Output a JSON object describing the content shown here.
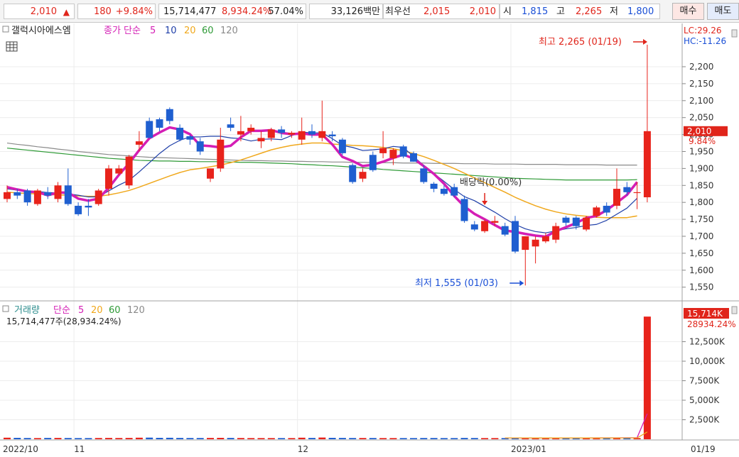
{
  "quote_bar": {
    "price": "2,010",
    "arrow": "▲",
    "change": "180",
    "change_pct": "+9.84%",
    "volume": "15,714,477",
    "volume_ratio": "8,934.24%",
    "turnover": "57.04%",
    "amount": "33,126백만",
    "best_bid_label": "최우선",
    "best_ask": "2,015",
    "best_bid": "2,010",
    "open_label": "시",
    "open": "1,815",
    "high_label": "고",
    "high": "2,265",
    "low_label": "저",
    "low": "1,800",
    "buy_label": "매수",
    "sell_label": "매도"
  },
  "price_legend": {
    "name": "갤럭시아에스엠",
    "ma_label": "종가 단순",
    "ma_periods": [
      "5",
      "10",
      "20",
      "60",
      "120"
    ]
  },
  "volume_legend": {
    "name": "거래량",
    "ma_label": "단순",
    "ma_periods": [
      "5",
      "20",
      "60",
      "120"
    ],
    "current_text": "15,714,477주(28,934.24%)"
  },
  "annotations": {
    "high_text": "최고 2,265 (01/19)",
    "low_text": "최저 1,555 (01/03)",
    "dividend_text": "배당락(0.00%)",
    "lc_text": "LC:29.26",
    "hc_text": "HC:-11.26",
    "last_price_tag": "2,010",
    "last_pct_tag": "9.84%",
    "last_vol_tag": "15,714K",
    "last_vol_pct_tag": "28934.24%"
  },
  "colors": {
    "up": "#e8231b",
    "down": "#1f5fd0",
    "ma5": "#d41eb5",
    "ma10": "#1f3fa8",
    "ma20": "#f0a81c",
    "ma60": "#2e9a36",
    "ma120": "#8a8a8a",
    "volume_ma5": "#d41eb5",
    "volume_ma20": "#f0a81c",
    "volume_ma60": "#2e9a36",
    "volume_ma120": "#8a8a8a"
  },
  "chart_data": {
    "type": "candlestick",
    "price_axis": {
      "range": [
        1520,
        2290
      ],
      "ticks": [
        1550,
        1600,
        1650,
        1700,
        1750,
        1800,
        1850,
        1900,
        1950,
        2000,
        2050,
        2100,
        2150,
        2200
      ],
      "tick_labels": [
        "1,550",
        "1,600",
        "1,650",
        "1,700",
        "1,750",
        "1,800",
        "1,850",
        "1,900",
        "1,950",
        "2,000",
        "2,050",
        "2,100",
        "2,150",
        "2,200"
      ]
    },
    "volume_axis": {
      "range": [
        0,
        16000
      ],
      "ticks": [
        2500,
        5000,
        7500,
        10000,
        12500
      ],
      "tick_labels": [
        "2,500K",
        "5,000K",
        "7,500K",
        "10,000K",
        "12,500K"
      ]
    },
    "x_axis": {
      "labels": [
        {
          "text": "2022/10",
          "index": 0
        },
        {
          "text": "11",
          "index": 7
        },
        {
          "text": "12",
          "index": 29
        },
        {
          "text": "2023/01",
          "index": 50
        },
        {
          "text": "01/19",
          "index": 63
        }
      ]
    },
    "candles": [
      {
        "o": 1810,
        "h": 1850,
        "l": 1800,
        "c": 1830
      },
      {
        "o": 1830,
        "h": 1840,
        "l": 1810,
        "c": 1820
      },
      {
        "o": 1835,
        "h": 1840,
        "l": 1790,
        "c": 1800
      },
      {
        "o": 1795,
        "h": 1840,
        "l": 1790,
        "c": 1835
      },
      {
        "o": 1830,
        "h": 1845,
        "l": 1810,
        "c": 1820
      },
      {
        "o": 1810,
        "h": 1860,
        "l": 1800,
        "c": 1850
      },
      {
        "o": 1850,
        "h": 1900,
        "l": 1790,
        "c": 1795
      },
      {
        "o": 1790,
        "h": 1800,
        "l": 1760,
        "c": 1765
      },
      {
        "o": 1790,
        "h": 1810,
        "l": 1760,
        "c": 1785
      },
      {
        "o": 1795,
        "h": 1840,
        "l": 1790,
        "c": 1835
      },
      {
        "o": 1840,
        "h": 1910,
        "l": 1820,
        "c": 1900
      },
      {
        "o": 1885,
        "h": 1910,
        "l": 1880,
        "c": 1900
      },
      {
        "o": 1850,
        "h": 1940,
        "l": 1840,
        "c": 1935
      },
      {
        "o": 1970,
        "h": 2010,
        "l": 1950,
        "c": 1980
      },
      {
        "o": 2040,
        "h": 2050,
        "l": 1990,
        "c": 1990
      },
      {
        "o": 2045,
        "h": 2050,
        "l": 2010,
        "c": 2020
      },
      {
        "o": 2075,
        "h": 2080,
        "l": 2030,
        "c": 2040
      },
      {
        "o": 2020,
        "h": 2030,
        "l": 1980,
        "c": 1985
      },
      {
        "o": 1995,
        "h": 2000,
        "l": 1970,
        "c": 1985
      },
      {
        "o": 1980,
        "h": 1990,
        "l": 1940,
        "c": 1950
      },
      {
        "o": 1870,
        "h": 1900,
        "l": 1860,
        "c": 1900
      },
      {
        "o": 1900,
        "h": 2020,
        "l": 1890,
        "c": 1985
      },
      {
        "o": 2030,
        "h": 2050,
        "l": 2010,
        "c": 2020
      },
      {
        "o": 2000,
        "h": 2055,
        "l": 1980,
        "c": 2010
      },
      {
        "o": 2010,
        "h": 2030,
        "l": 2000,
        "c": 2020
      },
      {
        "o": 1980,
        "h": 2010,
        "l": 1960,
        "c": 1990
      },
      {
        "o": 1990,
        "h": 2020,
        "l": 1980,
        "c": 2015
      },
      {
        "o": 2015,
        "h": 2025,
        "l": 1990,
        "c": 2005
      },
      {
        "o": 2000,
        "h": 2010,
        "l": 1990,
        "c": 2005
      },
      {
        "o": 1985,
        "h": 2050,
        "l": 1970,
        "c": 2010
      },
      {
        "o": 2010,
        "h": 2030,
        "l": 1990,
        "c": 2000
      },
      {
        "o": 1990,
        "h": 2100,
        "l": 1980,
        "c": 2010
      },
      {
        "o": 2000,
        "h": 2010,
        "l": 1980,
        "c": 1995
      },
      {
        "o": 1985,
        "h": 1990,
        "l": 1940,
        "c": 1945
      },
      {
        "o": 1910,
        "h": 1915,
        "l": 1855,
        "c": 1860
      },
      {
        "o": 1870,
        "h": 1900,
        "l": 1860,
        "c": 1890
      },
      {
        "o": 1940,
        "h": 1950,
        "l": 1890,
        "c": 1895
      },
      {
        "o": 1945,
        "h": 2010,
        "l": 1930,
        "c": 1960
      },
      {
        "o": 1930,
        "h": 1960,
        "l": 1910,
        "c": 1955
      },
      {
        "o": 1965,
        "h": 1970,
        "l": 1930,
        "c": 1935
      },
      {
        "o": 1945,
        "h": 1950,
        "l": 1920,
        "c": 1920
      },
      {
        "o": 1900,
        "h": 1910,
        "l": 1855,
        "c": 1860
      },
      {
        "o": 1855,
        "h": 1860,
        "l": 1830,
        "c": 1840
      },
      {
        "o": 1840,
        "h": 1850,
        "l": 1820,
        "c": 1825
      },
      {
        "o": 1845,
        "h": 1855,
        "l": 1815,
        "c": 1820
      },
      {
        "o": 1810,
        "h": 1820,
        "l": 1740,
        "c": 1745
      },
      {
        "o": 1735,
        "h": 1745,
        "l": 1715,
        "c": 1720
      },
      {
        "o": 1715,
        "h": 1750,
        "l": 1710,
        "c": 1745
      },
      {
        "o": 1740,
        "h": 1760,
        "l": 1730,
        "c": 1745
      },
      {
        "o": 1730,
        "h": 1740,
        "l": 1700,
        "c": 1705
      },
      {
        "o": 1745,
        "h": 1760,
        "l": 1650,
        "c": 1655
      },
      {
        "o": 1660,
        "h": 1700,
        "l": 1555,
        "c": 1700
      },
      {
        "o": 1670,
        "h": 1700,
        "l": 1620,
        "c": 1690
      },
      {
        "o": 1685,
        "h": 1710,
        "l": 1680,
        "c": 1700
      },
      {
        "o": 1690,
        "h": 1740,
        "l": 1680,
        "c": 1730
      },
      {
        "o": 1755,
        "h": 1760,
        "l": 1730,
        "c": 1740
      },
      {
        "o": 1755,
        "h": 1760,
        "l": 1720,
        "c": 1730
      },
      {
        "o": 1720,
        "h": 1760,
        "l": 1715,
        "c": 1755
      },
      {
        "o": 1760,
        "h": 1790,
        "l": 1755,
        "c": 1785
      },
      {
        "o": 1790,
        "h": 1800,
        "l": 1760,
        "c": 1770
      },
      {
        "o": 1790,
        "h": 1900,
        "l": 1780,
        "c": 1840
      },
      {
        "o": 1845,
        "h": 1860,
        "l": 1820,
        "c": 1830
      },
      {
        "o": 1830,
        "h": 1860,
        "l": 1780,
        "c": 1830
      },
      {
        "o": 1815,
        "h": 2265,
        "l": 1800,
        "c": 2010
      }
    ],
    "volume_k": [
      200,
      180,
      160,
      150,
      170,
      170,
      160,
      150,
      150,
      160,
      170,
      160,
      170,
      200,
      210,
      180,
      190,
      170,
      160,
      160,
      170,
      180,
      170,
      160,
      150,
      150,
      150,
      150,
      150,
      200,
      170,
      220,
      180,
      170,
      160,
      160,
      160,
      150,
      150,
      150,
      150,
      160,
      160,
      150,
      150,
      170,
      160,
      150,
      150,
      150,
      160,
      200,
      170,
      150,
      150,
      150,
      150,
      160,
      160,
      150,
      160,
      150,
      150,
      15714
    ],
    "ma_series": [
      {
        "name": "5",
        "values": [
          1845,
          1838,
          1832,
          1830,
          1821,
          1829,
          1829,
          1811,
          1805,
          1811,
          1843,
          1881,
          1915,
          1954,
          1989,
          2006,
          2021,
          2015,
          2001,
          1968,
          1966,
          1962,
          1967,
          1992,
          2011,
          2011,
          2013,
          2005,
          2001,
          2003,
          2000,
          2000,
          1971,
          1934,
          1922,
          1907,
          1911,
          1920,
          1931,
          1941,
          1929,
          1907,
          1884,
          1855,
          1819,
          1788,
          1766,
          1750,
          1733,
          1717,
          1713,
          1707,
          1702,
          1699,
          1715,
          1727,
          1739,
          1754,
          1760,
          1777,
          1799,
          1822,
          1860
        ]
      },
      {
        "name": "10",
        "values": [
          1840,
          1836,
          1834,
          1832,
          1829,
          1828,
          1825,
          1821,
          1816,
          1816,
          1834,
          1851,
          1865,
          1890,
          1917,
          1944,
          1967,
          1983,
          1993,
          1993,
          1995,
          1995,
          1990,
          1988,
          1981,
          1986,
          1987,
          1985,
          1997,
          2007,
          2005,
          2005,
          1988,
          1968,
          1962,
          1953,
          1955,
          1958,
          1965,
          1962,
          1935,
          1909,
          1885,
          1862,
          1838,
          1817,
          1805,
          1788,
          1771,
          1752,
          1735,
          1722,
          1714,
          1710,
          1716,
          1722,
          1726,
          1732,
          1735,
          1747,
          1765,
          1783,
          1812
        ]
      },
      {
        "name": "20",
        "values": [
          1830,
          1828,
          1826,
          1825,
          1823,
          1822,
          1821,
          1819,
          1818,
          1818,
          1822,
          1828,
          1835,
          1845,
          1856,
          1867,
          1878,
          1888,
          1896,
          1900,
          1905,
          1910,
          1917,
          1925,
          1935,
          1945,
          1955,
          1962,
          1968,
          1972,
          1975,
          1975,
          1972,
          1970,
          1968,
          1967,
          1965,
          1962,
          1958,
          1952,
          1944,
          1935,
          1924,
          1912,
          1900,
          1886,
          1872,
          1858,
          1844,
          1830,
          1815,
          1802,
          1790,
          1780,
          1772,
          1766,
          1762,
          1759,
          1756,
          1755,
          1755,
          1755,
          1760
        ]
      },
      {
        "name": "60",
        "values": [
          1960,
          1957,
          1954,
          1951,
          1948,
          1945,
          1942,
          1939,
          1936,
          1933,
          1930,
          1928,
          1926,
          1924,
          1923,
          1922,
          1922,
          1921,
          1921,
          1920,
          1920,
          1920,
          1919,
          1918,
          1918,
          1917,
          1916,
          1915,
          1914,
          1912,
          1911,
          1909,
          1908,
          1906,
          1904,
          1902,
          1900,
          1897,
          1895,
          1893,
          1891,
          1889,
          1887,
          1885,
          1883,
          1881,
          1879,
          1877,
          1875,
          1873,
          1871,
          1870,
          1869,
          1868,
          1867,
          1866,
          1866,
          1866,
          1866,
          1866,
          1866,
          1866,
          1867
        ]
      },
      {
        "name": "120",
        "values": [
          1975,
          1971,
          1968,
          1964,
          1961,
          1957,
          1954,
          1950,
          1947,
          1944,
          1941,
          1939,
          1937,
          1935,
          1933,
          1932,
          1931,
          1930,
          1929,
          1928,
          1927,
          1926,
          1925,
          1924,
          1923,
          1923,
          1922,
          1922,
          1921,
          1921,
          1920,
          1920,
          1919,
          1919,
          1918,
          1918,
          1917,
          1917,
          1917,
          1916,
          1916,
          1916,
          1915,
          1915,
          1915,
          1914,
          1914,
          1914,
          1913,
          1913,
          1913,
          1912,
          1912,
          1912,
          1912,
          1911,
          1911,
          1911,
          1911,
          1910,
          1910,
          1910,
          1910
        ]
      }
    ],
    "volume_ma_series": [
      {
        "name": "5",
        "values": [
          172,
          168,
          164,
          160,
          158,
          162,
          164,
          166,
          168,
          176,
          182,
          184,
          190,
          200,
          3270
        ]
      },
      {
        "name": "20",
        "values": [
          170,
          169,
          168,
          167,
          167,
          166,
          166,
          166,
          166,
          167,
          167,
          168,
          168,
          169,
          940
        ]
      }
    ]
  }
}
